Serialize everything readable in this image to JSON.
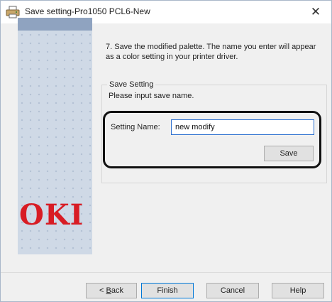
{
  "window": {
    "title": "Save setting-Pro1050 PCL6-New",
    "icon": "printer-app-icon",
    "close_glyph": "✕"
  },
  "side_panel": {
    "brand_logo": "OKI",
    "brand_color": "#d81c24"
  },
  "instruction": {
    "text": "7. Save the modified palette.  The name you enter will appear as a color setting in your printer driver."
  },
  "save_setting": {
    "group_title": "Save Setting",
    "description": "Please input save name.",
    "field_label": "Setting Name:",
    "field_value": "new modify",
    "save_label": "Save"
  },
  "footer": {
    "back_prefix": "< ",
    "back_mnemonic": "B",
    "back_rest": "ack",
    "finish_label": "Finish",
    "cancel_label": "Cancel",
    "help_label": "Help"
  },
  "colors": {
    "accent": "#0078d7",
    "highlight_outline": "#111111"
  }
}
